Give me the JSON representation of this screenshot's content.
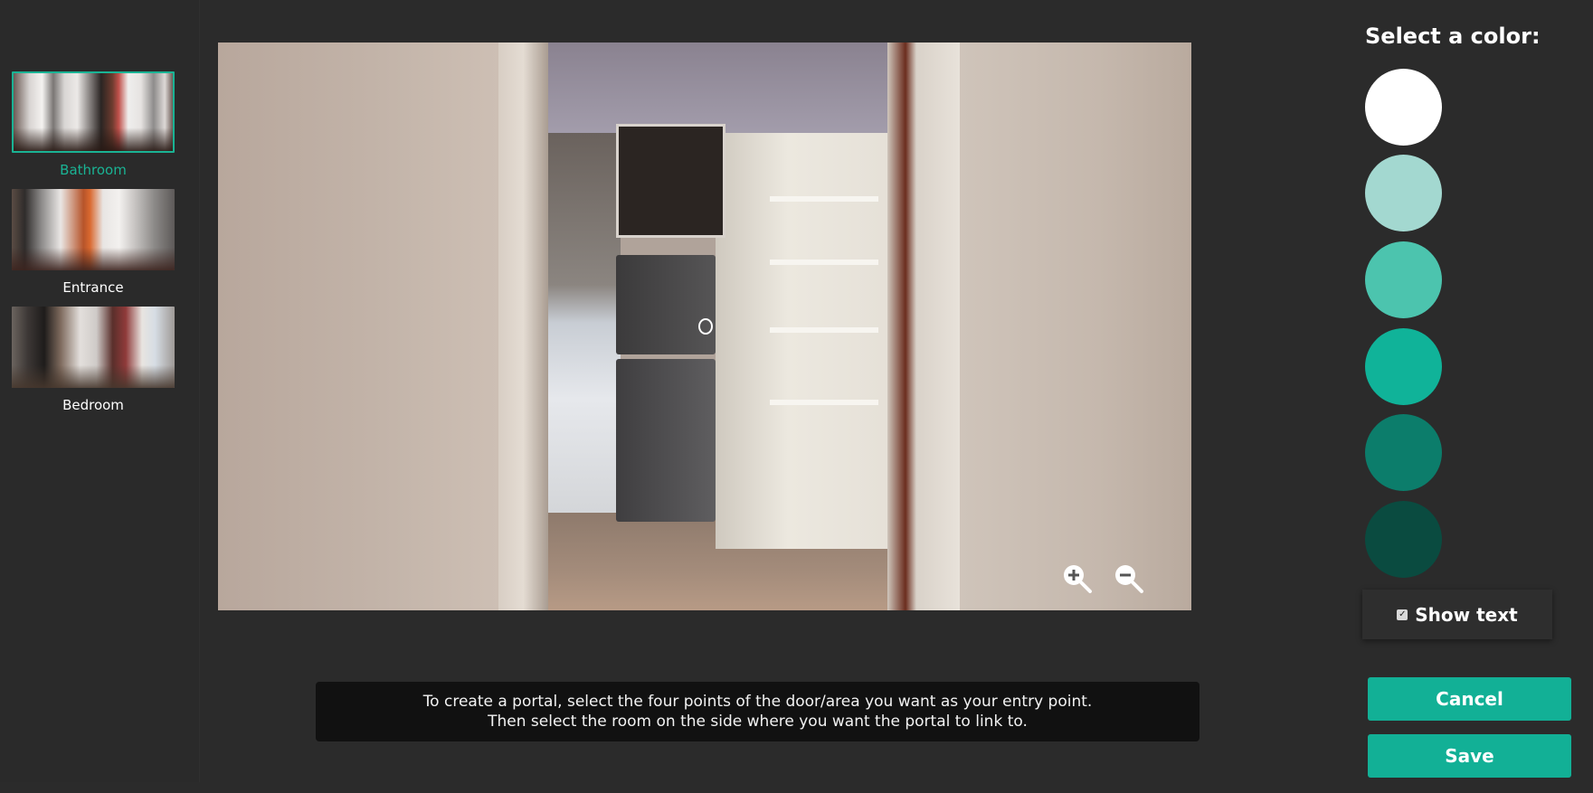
{
  "rooms": [
    {
      "label": "Bathroom",
      "selected": true
    },
    {
      "label": "Entrance",
      "selected": false
    },
    {
      "label": "Bedroom",
      "selected": false
    }
  ],
  "instructions": {
    "line1": "To create a portal, select the four points of the door/area you want as your entry point.",
    "line2": "Then select the room on the side where you want the portal to link to."
  },
  "color_panel": {
    "title": "Select a color:",
    "swatches": [
      "#ffffff",
      "#a3d8d0",
      "#4cc4ae",
      "#10b399",
      "#0c7d6b",
      "#0a4b40"
    ]
  },
  "show_text": {
    "label": "Show text",
    "checked": true
  },
  "buttons": {
    "cancel": "Cancel",
    "save": "Save"
  },
  "accent_color": "#12b096",
  "zoom": {
    "in_icon": "zoom-in-icon",
    "out_icon": "zoom-out-icon"
  }
}
